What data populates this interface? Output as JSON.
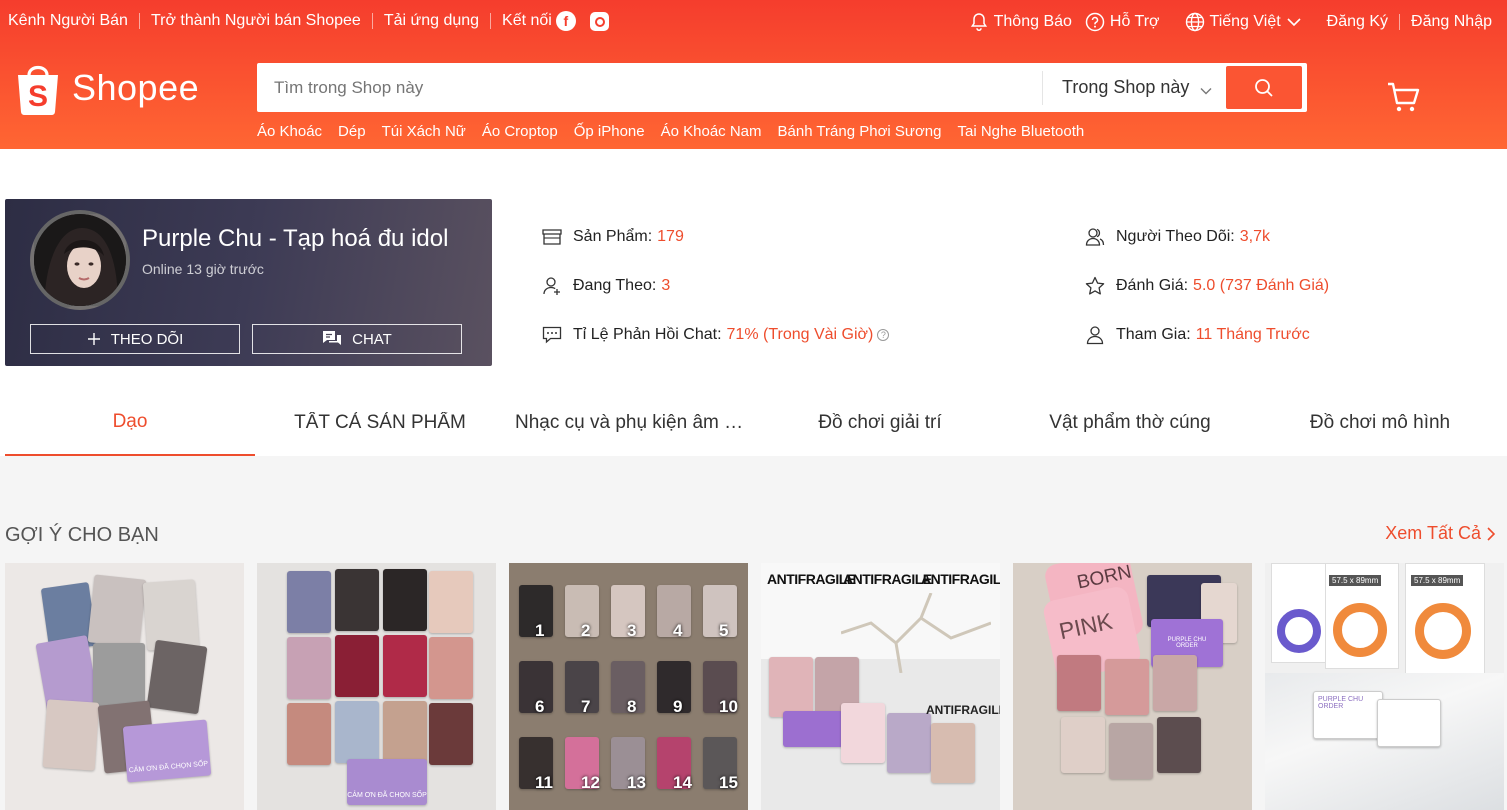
{
  "topbar": {
    "seller_center": "Kênh Người Bán",
    "become_seller": "Trở thành Người bán Shopee",
    "download_app": "Tải ứng dụng",
    "connect": "Kết nối",
    "facebook_glyph": "f",
    "notifications": "Thông Báo",
    "help": "Hỗ Trợ",
    "language": "Tiếng Việt",
    "register": "Đăng Ký",
    "login": "Đăng Nhập"
  },
  "brand": {
    "name": "Shopee",
    "logo_letter": "S",
    "color": "#ee4d2d"
  },
  "search": {
    "placeholder": "Tìm trong Shop này",
    "scope": "Trong Shop này"
  },
  "keywords": [
    "Áo Khoác",
    "Dép",
    "Túi Xách Nữ",
    "Áo Croptop",
    "Ốp iPhone",
    "Áo Khoác Nam",
    "Bánh Tráng Phơi Sương",
    "Tai Nghe Bluetooth"
  ],
  "shop": {
    "name": "Purple Chu - Tạp hoá đu idol",
    "status": "Online 13 giờ trước",
    "follow_button": "THEO DÕI",
    "chat_button": "CHAT"
  },
  "stats": {
    "products_label": "Sản Phẩm:",
    "products_value": "179",
    "following_label": "Đang Theo:",
    "following_value": "3",
    "response_label": "Tỉ Lệ Phản Hồi Chat:",
    "response_value": "71% (Trong Vài Giờ)",
    "followers_label": "Người Theo Dõi:",
    "followers_value": "3,7k",
    "rating_label": "Đánh Giá:",
    "rating_value": "5.0 (737 Đánh Giá)",
    "joined_label": "Tham Gia:",
    "joined_value": "11 Tháng Trước",
    "help_glyph": "?"
  },
  "tabs": [
    "Dạo",
    "TẤT CẢ SẢN PHẨM",
    "Nhạc cụ và phụ kiện âm thanh",
    "Đồ chơi giải trí",
    "Vật phẩm thờ cúng",
    "Đồ chơi mô hình"
  ],
  "recommendations": {
    "title": "GỢI Ý CHO BẠN",
    "see_all": "Xem Tất Cả",
    "image_texts": {
      "thank_you": "CẢM ƠN ĐÃ CHỌN SỐP",
      "card_title": "PURPLE CHU ORDER",
      "antifragile": "ANTIFRAGILE",
      "pink_tin_top": "BORN",
      "pink_tin_bottom": "PINK",
      "sleeve_size": "57.5 x 89mm"
    },
    "photocard_numbers": [
      "1",
      "2",
      "3",
      "4",
      "5",
      "6",
      "7",
      "8",
      "9",
      "10",
      "11",
      "12",
      "13",
      "14",
      "15"
    ]
  }
}
